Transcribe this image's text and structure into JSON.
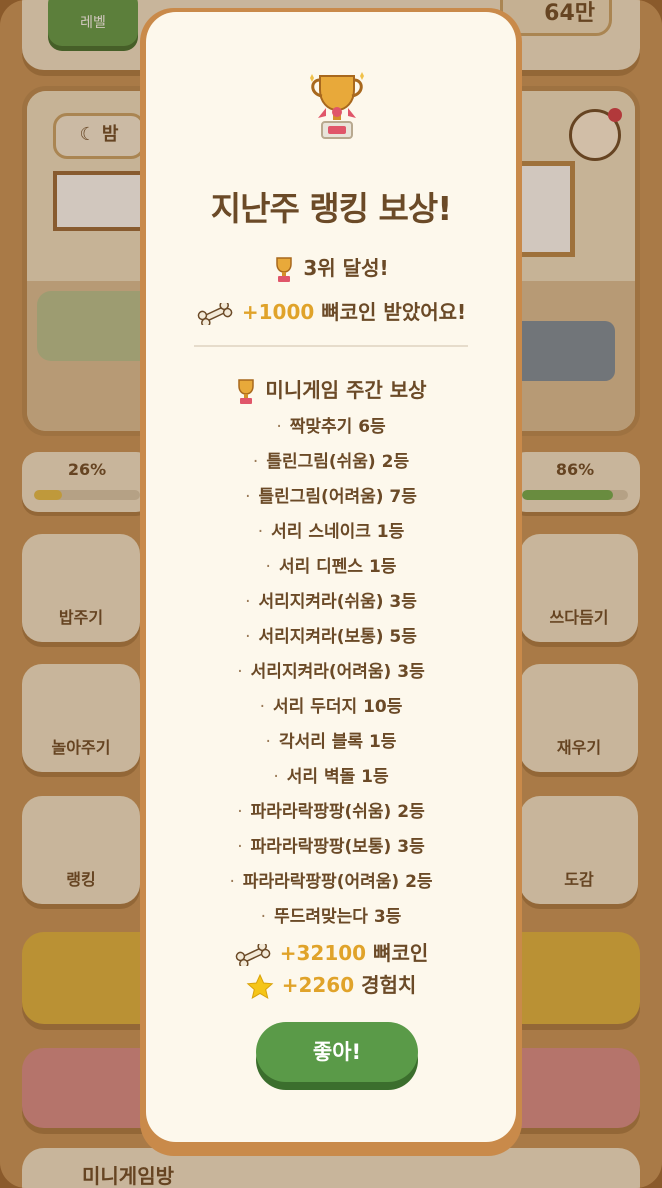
{
  "background": {
    "level_label": "레벨",
    "coins_partial": "64만",
    "time_of_day": "밤",
    "stats": [
      {
        "percent": "26%",
        "fill": 0.26,
        "color": "#e6c04a"
      },
      {
        "percent": "86%",
        "fill": 0.86,
        "color": "#6fae4f"
      }
    ],
    "menu_left": [
      "밥주기",
      "놀아주기",
      "랭킹"
    ],
    "menu_right": [
      "쓰다듬기",
      "재우기",
      "도감"
    ],
    "bottom_label": "미니게임방"
  },
  "modal": {
    "title": "지난주 랭킹 보상!",
    "rank_text": "3위 달성!",
    "reward_amount": "+1000",
    "reward_suffix": "뼈코인 받았어요!",
    "section_title": "미니게임 주간 보상",
    "minigame_results": [
      "짝맞추기 6등",
      "틀린그림(쉬움) 2등",
      "틀린그림(어려움) 7등",
      "서리 스네이크 1등",
      "서리 디펜스 1등",
      "서리지켜라(쉬움) 3등",
      "서리지켜라(보통) 5등",
      "서리지켜라(어려움) 3등",
      "서리 두더지 10등",
      "각서리 블록 1등",
      "서리 벽돌 1등",
      "파라라락팡팡(쉬움) 2등",
      "파라라락팡팡(보통) 3등",
      "파라라락팡팡(어려움) 2등",
      "뚜드려맞는다 3등"
    ],
    "total_coin_amount": "+32100",
    "total_coin_suffix": "뼈코인",
    "total_exp_amount": "+2260",
    "total_exp_suffix": "경험치",
    "ok_label": "좋아!"
  }
}
